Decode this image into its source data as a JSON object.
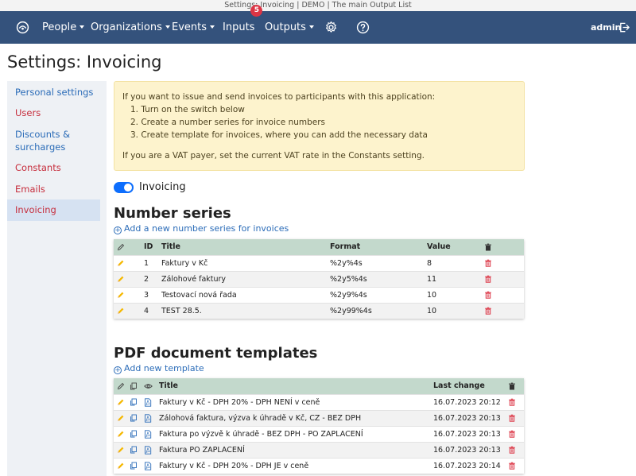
{
  "window": {
    "title": "Settings: Invoicing | DEMO | The main Output List"
  },
  "navbar": {
    "menu": [
      {
        "label": "People",
        "dropdown": true
      },
      {
        "label": "Organizations",
        "dropdown": true
      },
      {
        "label": "Events",
        "dropdown": true
      },
      {
        "label": "Inputs",
        "dropdown": false,
        "badge": "5"
      },
      {
        "label": "Outputs",
        "dropdown": true
      }
    ],
    "user": "admin",
    "icons": [
      "logo-icon",
      "gear-icon",
      "help-icon",
      "logout-icon"
    ],
    "background": "#34527c",
    "badge_color": "#dc3545"
  },
  "page": {
    "title": "Settings: Invoicing"
  },
  "sidebar": {
    "items": [
      {
        "label": "Personal settings",
        "active": false
      },
      {
        "label": "Users",
        "active": false
      },
      {
        "label": "Discounts & surcharges",
        "active": false
      },
      {
        "label": "Constants",
        "active": false
      },
      {
        "label": "Emails",
        "active": false
      },
      {
        "label": "Invoicing",
        "active": true
      }
    ]
  },
  "info": {
    "intro": "If you want to issue and send invoices to participants with this application:",
    "steps": [
      "1. Turn on the switch below",
      "2. Create a number series for invoice numbers",
      "3. Create template for invoices, where you can add the necessary data"
    ],
    "vat_note": "If you are a VAT payer, set the current VAT rate in the Constants setting."
  },
  "toggle": {
    "label": "Invoicing",
    "checked": true
  },
  "number_series": {
    "heading": "Number series",
    "add_label": "Add a new number series for invoices",
    "columns": {
      "id": "ID",
      "title": "Title",
      "format": "Format",
      "value": "Value"
    },
    "rows": [
      {
        "id": "1",
        "title": "Faktury v Kč",
        "format": "%2y%4s",
        "value": "8"
      },
      {
        "id": "2",
        "title": "Zálohové faktury",
        "format": "%2y5%4s",
        "value": "11"
      },
      {
        "id": "3",
        "title": "Testovací nová řada",
        "format": "%2y9%4s",
        "value": "10"
      },
      {
        "id": "4",
        "title": "TEST 28.5.",
        "format": "%2y99%4s",
        "value": "10"
      }
    ]
  },
  "templates": {
    "heading": "PDF document templates",
    "add_label": "Add new template",
    "columns": {
      "title": "Title",
      "last_change": "Last change"
    },
    "rows": [
      {
        "title": "Faktury v Kč - DPH 20% - DPH NENÍ v ceně",
        "last_change": "16.07.2023 20:12"
      },
      {
        "title": "Zálohová faktura, výzva k úhradě v Kč, CZ - BEZ DPH",
        "last_change": "16.07.2023 20:13"
      },
      {
        "title": "Faktura po výzvě k úhradě - BEZ DPH - PO ZAPLACENÍ",
        "last_change": "16.07.2023 20:13"
      },
      {
        "title": "Faktura PO ZAPLACENÍ",
        "last_change": "16.07.2023 20:13"
      },
      {
        "title": "Faktury v Kč - DPH 20% - DPH JE v ceně",
        "last_change": "16.07.2023 20:14"
      }
    ]
  },
  "colors": {
    "table_header": "#c3d9cc",
    "link": "#2b6cb8",
    "danger": "#dc3545",
    "pencil": "#f5b800",
    "info_bg": "#fdf3cd"
  }
}
